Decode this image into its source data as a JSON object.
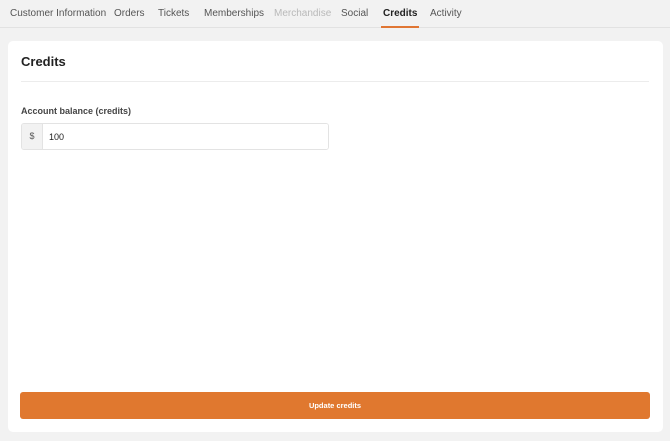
{
  "tabs": [
    {
      "label": "Customer Information",
      "state": "normal"
    },
    {
      "label": "Orders",
      "state": "normal"
    },
    {
      "label": "Tickets",
      "state": "normal"
    },
    {
      "label": "Memberships",
      "state": "normal"
    },
    {
      "label": "Merchandise",
      "state": "disabled"
    },
    {
      "label": "Social",
      "state": "normal"
    },
    {
      "label": "Credits",
      "state": "active"
    },
    {
      "label": "Activity",
      "state": "normal"
    }
  ],
  "credits": {
    "title": "Credits",
    "balance_label": "Account balance (credits)",
    "currency_prefix": "$",
    "balance_value": "100",
    "update_button_label": "Update credits"
  },
  "colors": {
    "accent": "#e0782f",
    "background": "#f2f2f2",
    "card": "#ffffff",
    "disabled_text": "#b9b9b9"
  }
}
